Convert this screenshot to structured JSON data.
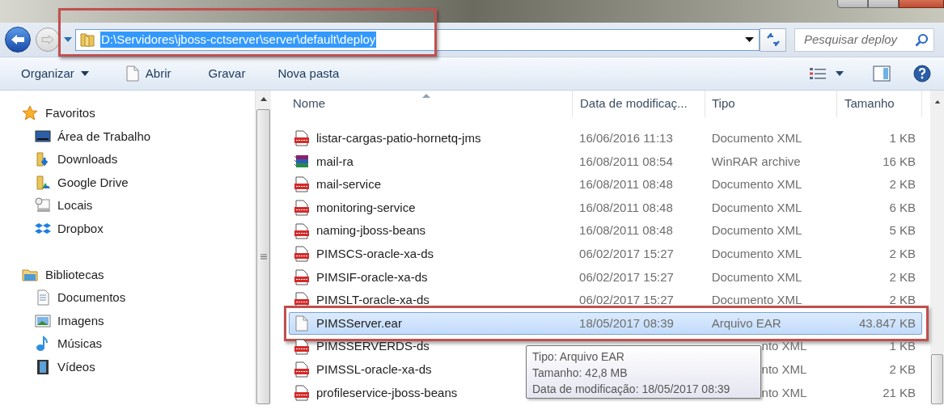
{
  "address": {
    "path": "D:\\Servidores\\jboss-cctserver\\server\\default\\deploy",
    "highlight": true
  },
  "search": {
    "placeholder": "Pesquisar deploy"
  },
  "toolbar": [
    {
      "label": "Organizar",
      "kind": "menu"
    },
    {
      "label": "Abrir",
      "kind": "open"
    },
    {
      "label": "Gravar",
      "kind": "plain"
    },
    {
      "label": "Nova pasta",
      "kind": "plain"
    }
  ],
  "nav": [
    {
      "label": "Favoritos",
      "kind": "star",
      "children": [
        {
          "label": "Área de Trabalho",
          "kind": "desktop"
        },
        {
          "label": "Downloads",
          "kind": "downloads"
        },
        {
          "label": "Google Drive",
          "kind": "drive"
        },
        {
          "label": "Locais",
          "kind": "recent"
        },
        {
          "label": "Dropbox",
          "kind": "dropbox"
        }
      ]
    },
    {
      "label": "Bibliotecas",
      "kind": "library",
      "children": [
        {
          "label": "Documentos",
          "kind": "documents"
        },
        {
          "label": "Imagens",
          "kind": "pictures"
        },
        {
          "label": "Músicas",
          "kind": "music"
        },
        {
          "label": "Vídeos",
          "kind": "videos"
        }
      ]
    }
  ],
  "columns": [
    "Nome",
    "Data de modificaç...",
    "Tipo",
    "Tamanho"
  ],
  "files": [
    {
      "name": "listar-cargas-patio-hornetq-jms",
      "date": "16/06/2016 11:13",
      "type": "Documento XML",
      "size": "1 KB",
      "kind": "xml",
      "selected": false
    },
    {
      "name": "mail-ra",
      "date": "16/08/2011 08:54",
      "type": "WinRAR archive",
      "size": "16 KB",
      "kind": "rar",
      "selected": false
    },
    {
      "name": "mail-service",
      "date": "16/08/2011 08:48",
      "type": "Documento XML",
      "size": "2 KB",
      "kind": "xml",
      "selected": false
    },
    {
      "name": "monitoring-service",
      "date": "16/08/2011 08:48",
      "type": "Documento XML",
      "size": "6 KB",
      "kind": "xml",
      "selected": false
    },
    {
      "name": "naming-jboss-beans",
      "date": "16/08/2011 08:48",
      "type": "Documento XML",
      "size": "5 KB",
      "kind": "xml",
      "selected": false
    },
    {
      "name": "PIMSCS-oracle-xa-ds",
      "date": "06/02/2017 15:27",
      "type": "Documento XML",
      "size": "2 KB",
      "kind": "xml",
      "selected": false
    },
    {
      "name": "PIMSIF-oracle-xa-ds",
      "date": "06/02/2017 15:27",
      "type": "Documento XML",
      "size": "2 KB",
      "kind": "xml",
      "selected": false
    },
    {
      "name": "PIMSLT-oracle-xa-ds",
      "date": "06/02/2017 15:27",
      "type": "Documento XML",
      "size": "2 KB",
      "kind": "xml",
      "selected": false
    },
    {
      "name": "PIMSServer.ear",
      "date": "18/05/2017 08:39",
      "type": "Arquivo EAR",
      "size": "43.847 KB",
      "kind": "file",
      "selected": true,
      "highlight": true
    },
    {
      "name": "PIMSSERVERDS-ds",
      "type": "nto XML",
      "size": "1 KB",
      "kind": "xml",
      "selected": false,
      "under_tooltip": true
    },
    {
      "name": "PIMSSL-oracle-xa-ds",
      "type": "nto XML",
      "size": "2 KB",
      "kind": "xml",
      "selected": false,
      "under_tooltip": true
    },
    {
      "name": "profileservice-jboss-beans",
      "type": "nto XML",
      "size": "21 KB",
      "kind": "xml",
      "selected": false,
      "under_tooltip": true
    }
  ],
  "tooltip": [
    "Tipo: Arquivo EAR",
    "Tamanho: 42,8 MB",
    "Data de modificação: 18/05/2017 08:39"
  ]
}
